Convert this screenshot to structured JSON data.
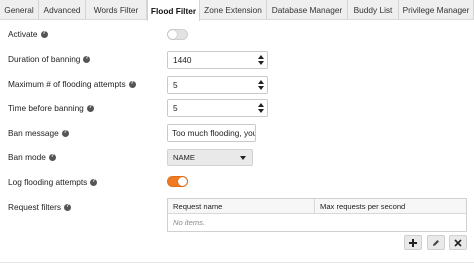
{
  "tabs": [
    {
      "label": "General"
    },
    {
      "label": "Advanced"
    },
    {
      "label": "Words Filter"
    },
    {
      "label": "Flood Filter"
    },
    {
      "label": "Zone Extension"
    },
    {
      "label": "Database Manager"
    },
    {
      "label": "Buddy List"
    },
    {
      "label": "Privilege Manager"
    }
  ],
  "active_tab": "Flood Filter",
  "form": {
    "activate": {
      "label": "Activate",
      "checked": false
    },
    "duration": {
      "label": "Duration of banning",
      "value": "1440"
    },
    "max_attempts": {
      "label": "Maximum # of flooding attempts",
      "value": "5"
    },
    "time_before": {
      "label": "Time before banning",
      "value": "5"
    },
    "ban_message": {
      "label": "Ban message",
      "value": "Too much flooding, you"
    },
    "ban_mode": {
      "label": "Ban mode",
      "value": "NAME"
    },
    "log_attempts": {
      "label": "Log flooding attempts",
      "checked": true
    },
    "request_filters": {
      "label": "Request filters"
    }
  },
  "table": {
    "columns": [
      "Request name",
      "Max requests per second"
    ],
    "empty_text": "No items."
  },
  "help_glyph": "?",
  "icons": {
    "help": "question-circle-icon",
    "add": "plus-icon",
    "edit": "pencil-icon",
    "remove": "close-icon"
  },
  "colors": {
    "toggle_on": "#f07a22",
    "toggle_off": "#e2e2e2"
  }
}
